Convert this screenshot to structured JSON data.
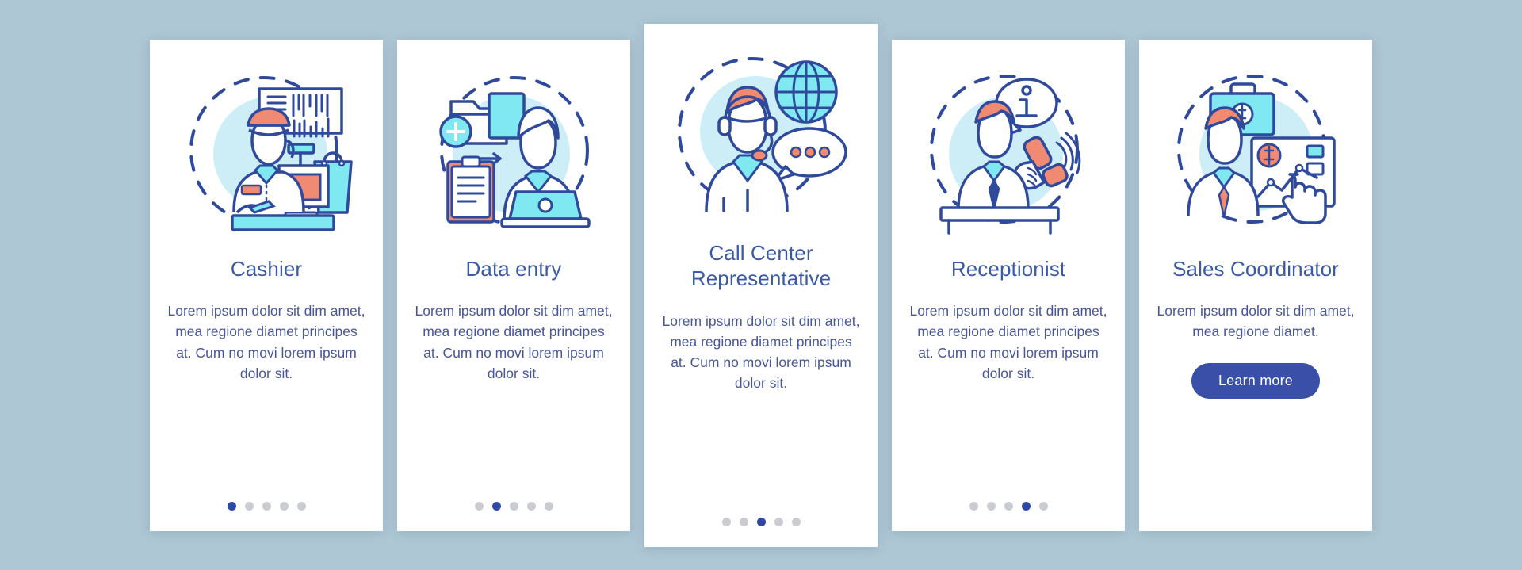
{
  "background_color": "#aec7d4",
  "theme": {
    "card_bg": "#ffffff",
    "title_color": "#3b5aa6",
    "body_color": "#48569b",
    "line_color": "#2f4a9c",
    "coral": "#f08a72",
    "cyan": "#7fe8f0",
    "circle_bg": "#cdeef7",
    "dot_active": "#2f47a6",
    "dot_inactive": "#c9cdd2",
    "button_bg": "#3a4fa8",
    "button_text": "#ffffff"
  },
  "cards": [
    {
      "illustration": "cashier-illustration",
      "title": "Cashier",
      "description": "Lorem ipsum dolor sit dim amet, mea regione diamet principes at. Cum no movi lorem ipsum dolor sit.",
      "dots": {
        "count": 5,
        "active_index": 0
      },
      "button": null
    },
    {
      "illustration": "data-entry-illustration",
      "title": "Data entry",
      "description": "Lorem ipsum dolor sit dim amet, mea regione diamet principes at. Cum no movi lorem ipsum dolor sit.",
      "dots": {
        "count": 5,
        "active_index": 1
      },
      "button": null
    },
    {
      "illustration": "call-center-illustration",
      "title": "Call Center Representative",
      "description": "Lorem ipsum dolor sit dim amet, mea regione diamet principes at. Cum no movi lorem ipsum dolor sit.",
      "dots": {
        "count": 5,
        "active_index": 2
      },
      "button": null
    },
    {
      "illustration": "receptionist-illustration",
      "title": "Receptionist",
      "description": "Lorem ipsum dolor sit dim amet, mea regione diamet principes at. Cum no movi lorem ipsum dolor sit.",
      "dots": {
        "count": 5,
        "active_index": 3
      },
      "button": null
    },
    {
      "illustration": "sales-coordinator-illustration",
      "title": "Sales Coordinator",
      "description": "Lorem ipsum dolor sit dim amet, mea regione diamet.",
      "dots": null,
      "button": {
        "label": "Learn more"
      }
    }
  ]
}
